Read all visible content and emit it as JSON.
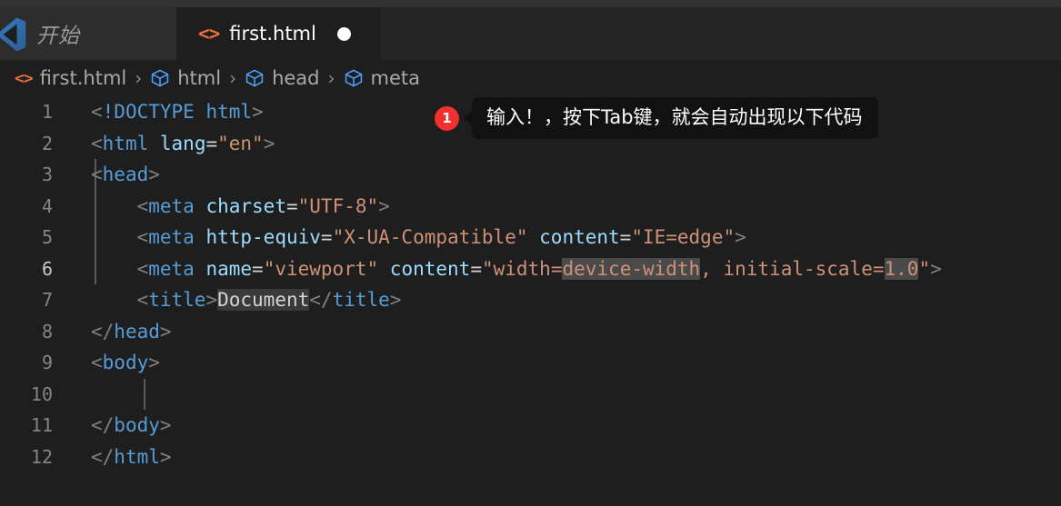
{
  "window": {
    "home_tab_label": "开始",
    "home_tab_icon": "vscode-logo-icon"
  },
  "tabs": [
    {
      "label": "first.html",
      "icon": "html-angle-bracket-icon",
      "dirty": true,
      "active": true
    }
  ],
  "breadcrumb": {
    "items": [
      {
        "label": "first.html",
        "icon": "html-angle-bracket-icon"
      },
      {
        "label": "html",
        "icon": "symbol-cube-icon"
      },
      {
        "label": "head",
        "icon": "symbol-cube-icon"
      },
      {
        "label": "meta",
        "icon": "symbol-cube-icon"
      }
    ],
    "separator": "›"
  },
  "annotation": {
    "badge": "1",
    "text": "输入！，按下Tab键，就会自动出现以下代码"
  },
  "editor": {
    "active_line": 6,
    "line_numbers": [
      "1",
      "2",
      "3",
      "4",
      "5",
      "6",
      "7",
      "8",
      "9",
      "10",
      "11",
      "12"
    ],
    "lines": [
      {
        "n": "1",
        "text": "<!DOCTYPE html>"
      },
      {
        "n": "2",
        "text": "<html lang=\"en\">"
      },
      {
        "n": "3",
        "text": "<head>"
      },
      {
        "n": "4",
        "text": "    <meta charset=\"UTF-8\">"
      },
      {
        "n": "5",
        "text": "    <meta http-equiv=\"X-UA-Compatible\" content=\"IE=edge\">"
      },
      {
        "n": "6",
        "text": "    <meta name=\"viewport\" content=\"width=device-width, initial-scale=1.0\">"
      },
      {
        "n": "7",
        "text": "    <title>Document</title>"
      },
      {
        "n": "8",
        "text": "</head>"
      },
      {
        "n": "9",
        "text": "<body>"
      },
      {
        "n": "10",
        "text": "    "
      },
      {
        "n": "11",
        "text": "</body>"
      },
      {
        "n": "12",
        "text": "</html>"
      }
    ],
    "highlighted_tokens": [
      "device-width",
      "1.0",
      "Document"
    ]
  },
  "colors": {
    "editor_bg": "#1e1e1e",
    "tabbar_bg": "#252526",
    "top_strip_bg": "#323233",
    "tag": "#569cd6",
    "attribute": "#9cdcfe",
    "string": "#ce9178",
    "punctuation": "#808080",
    "accent_orange": "#e8703a",
    "badge_red": "#f23030",
    "tooltip_bg": "#111111",
    "line_number": "#858585"
  }
}
